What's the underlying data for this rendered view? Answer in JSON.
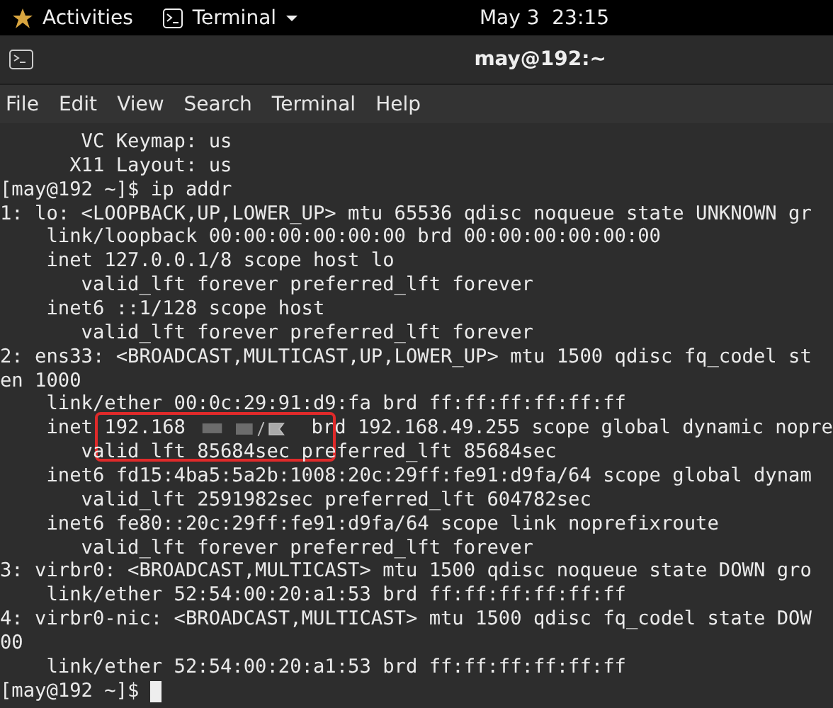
{
  "top_bar": {
    "activities": "Activities",
    "app_menu": "Terminal",
    "clock": "May 3  23:15"
  },
  "window": {
    "title": "may@192:~"
  },
  "menu": [
    "File",
    "Edit",
    "View",
    "Search",
    "Terminal",
    "Help"
  ],
  "terminal": {
    "lines": [
      {
        "kind": "text",
        "text": "       VC Keymap: us"
      },
      {
        "kind": "text",
        "text": "      X11 Layout: us"
      },
      {
        "kind": "text",
        "text": "[may@192 ~]$ ip addr"
      },
      {
        "kind": "text",
        "text": "1: lo: <LOOPBACK,UP,LOWER_UP> mtu 65536 qdisc noqueue state UNKNOWN gr"
      },
      {
        "kind": "text",
        "text": "    link/loopback 00:00:00:00:00:00 brd 00:00:00:00:00:00"
      },
      {
        "kind": "text",
        "text": "    inet 127.0.0.1/8 scope host lo"
      },
      {
        "kind": "text",
        "text": "       valid_lft forever preferred_lft forever"
      },
      {
        "kind": "text",
        "text": "    inet6 ::1/128 scope host"
      },
      {
        "kind": "text",
        "text": "       valid_lft forever preferred_lft forever"
      },
      {
        "kind": "text",
        "text": "2: ens33: <BROADCAST,MULTICAST,UP,LOWER_UP> mtu 1500 qdisc fq_codel st"
      },
      {
        "kind": "text",
        "text": "en 1000"
      },
      {
        "kind": "text",
        "text": "    link/ether 00:0c:29:91:d9:fa brd ff:ff:ff:ff:ff:ff"
      },
      {
        "kind": "redacted",
        "before": "    inet 192.168",
        "after": "brd 192.168.49.255 scope global dynamic nopre"
      },
      {
        "kind": "text",
        "text": "       valid lft 85684sec preferred_lft 85684sec"
      },
      {
        "kind": "text",
        "text": "    inet6 fd15:4ba5:5a2b:1008:20c:29ff:fe91:d9fa/64 scope global dynam"
      },
      {
        "kind": "text",
        "text": "       valid_lft 2591982sec preferred_lft 604782sec"
      },
      {
        "kind": "text",
        "text": "    inet6 fe80::20c:29ff:fe91:d9fa/64 scope link noprefixroute"
      },
      {
        "kind": "text",
        "text": "       valid_lft forever preferred_lft forever"
      },
      {
        "kind": "text",
        "text": "3: virbr0: <BROADCAST,MULTICAST> mtu 1500 qdisc noqueue state DOWN gro"
      },
      {
        "kind": "text",
        "text": "    link/ether 52:54:00:20:a1:53 brd ff:ff:ff:ff:ff:ff"
      },
      {
        "kind": "text",
        "text": "4: virbr0-nic: <BROADCAST,MULTICAST> mtu 1500 qdisc fq_codel state DOW"
      },
      {
        "kind": "text",
        "text": "00"
      },
      {
        "kind": "text",
        "text": "    link/ether 52:54:00:20:a1:53 brd ff:ff:ff:ff:ff:ff"
      },
      {
        "kind": "prompt",
        "text": "[may@192 ~]$ "
      }
    ]
  }
}
